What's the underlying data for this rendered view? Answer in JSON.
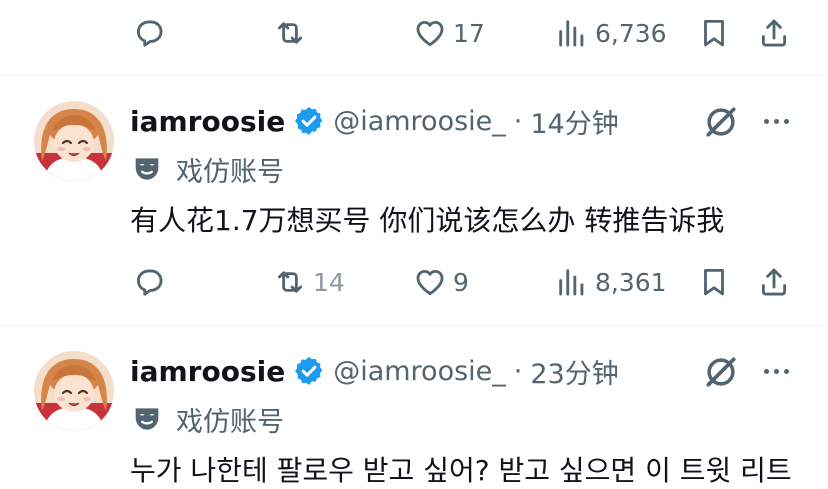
{
  "top_actions": {
    "reply_count": "",
    "retweet_count": "",
    "like_count": "17",
    "view_count": "6,736"
  },
  "tweets": [
    {
      "name": "iamroosie",
      "handle": "@iamroosie_",
      "separator": "·",
      "time": "14分钟",
      "parody_label": "戏仿账号",
      "text": "有人花1.7万想买号 你们说该怎么办 转推告诉我",
      "reply_count": "",
      "retweet_count": "14",
      "like_count": "9",
      "view_count": "8,361"
    },
    {
      "name": "iamroosie",
      "handle": "@iamroosie_",
      "separator": "·",
      "time": "23分钟",
      "parody_label": "戏仿账号",
      "text": "누가 나한테 팔로우 받고 싶어? 받고 싶으면 이 트윗 리트"
    }
  ],
  "icons": {
    "verified": "verified-badge-icon",
    "grok": "grok-icon",
    "more": "more-icon",
    "mask": "mask-icon",
    "reply": "reply-icon",
    "retweet": "retweet-icon",
    "like": "heart-icon",
    "views": "views-icon",
    "bookmark": "bookmark-icon",
    "share": "share-icon"
  },
  "colors": {
    "accent_blue": "#1d9bf0",
    "text_primary": "#0f1419",
    "text_secondary": "#536471",
    "divider": "#eff3f4"
  }
}
